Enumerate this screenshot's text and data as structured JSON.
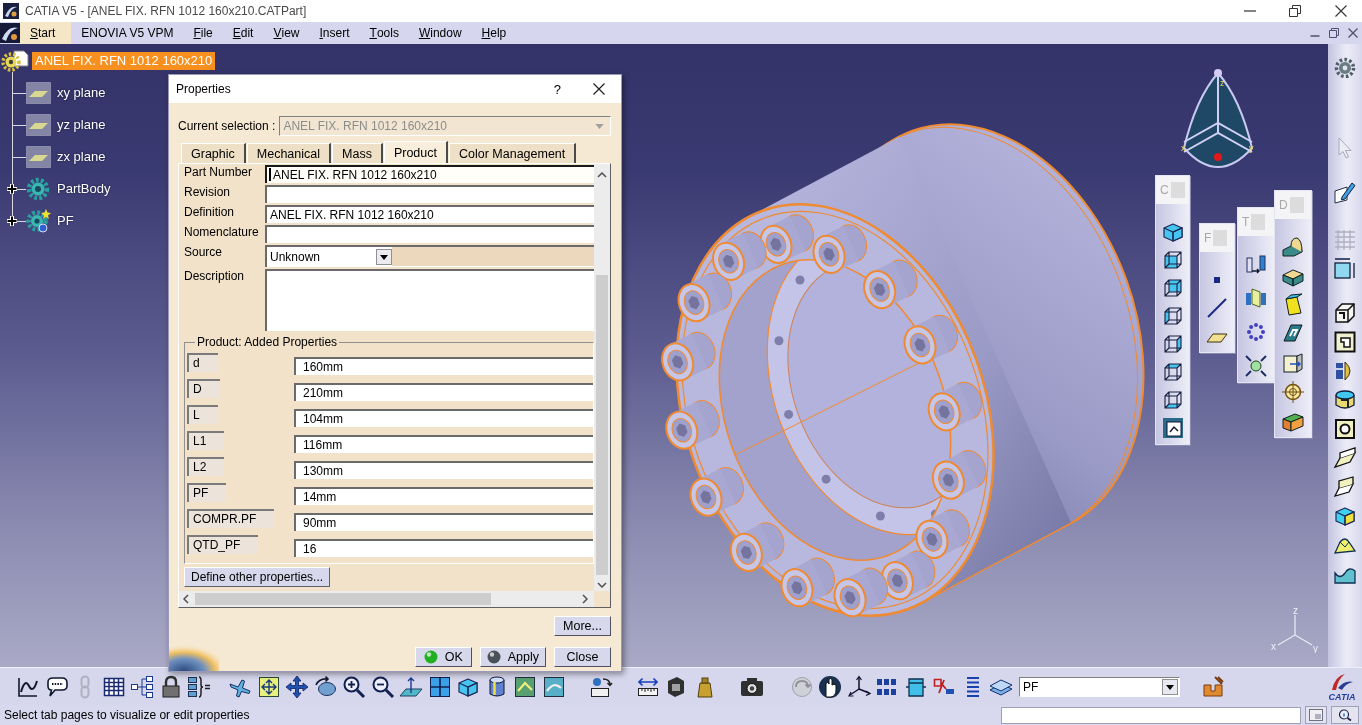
{
  "window": {
    "title": "CATIA V5 - [ANEL FIX. RFN 1012 160x210.CATPart]"
  },
  "menu": [
    {
      "label": "Start",
      "mnemonic": true,
      "selected": true
    },
    {
      "label": "ENOVIA V5 VPM",
      "mnemonic": false,
      "selected": false
    },
    {
      "label": "File",
      "mnemonic": true,
      "selected": false
    },
    {
      "label": "Edit",
      "mnemonic": true,
      "selected": false
    },
    {
      "label": "View",
      "mnemonic": true,
      "selected": false
    },
    {
      "label": "Insert",
      "mnemonic": true,
      "selected": false
    },
    {
      "label": "Tools",
      "mnemonic": true,
      "selected": false
    },
    {
      "label": "Window",
      "mnemonic": true,
      "selected": false
    },
    {
      "label": "Help",
      "mnemonic": true,
      "selected": false
    }
  ],
  "tree": {
    "label": "ANEL FIX. RFN 1012 160x210",
    "selected": true,
    "children": [
      {
        "label": "xy plane",
        "kind": "plane",
        "selected": false
      },
      {
        "label": "yz plane",
        "kind": "plane",
        "selected": false
      },
      {
        "label": "zx plane",
        "kind": "plane",
        "selected": false
      },
      {
        "label": "PartBody",
        "kind": "body",
        "expanded": false,
        "selected": false
      },
      {
        "label": "PF",
        "kind": "set",
        "expanded": false,
        "selected": false
      }
    ]
  },
  "compass": {
    "labels": [
      "z",
      "x",
      "y"
    ]
  },
  "floating_toolbars": [
    {
      "title": "C"
    },
    {
      "title": "F"
    },
    {
      "title": "T"
    },
    {
      "title": "D"
    }
  ],
  "axis_triad": {
    "labels": [
      "z",
      "x",
      "y"
    ]
  },
  "dialog": {
    "title": "Properties",
    "help": "?",
    "current_selection": {
      "label": "Current selection :",
      "value": "ANEL FIX. RFN 1012 160x210",
      "disabled": true
    },
    "tabs": [
      {
        "label": "Graphic",
        "selected": false
      },
      {
        "label": "Mechanical",
        "selected": false
      },
      {
        "label": "Mass",
        "selected": false
      },
      {
        "label": "Product",
        "selected": true
      },
      {
        "label": "Color Management",
        "selected": false
      }
    ],
    "fields": [
      {
        "label": "Part Number",
        "kind": "text",
        "value": "ANEL FIX. RFN 1012 160x210",
        "focused": true
      },
      {
        "label": "Revision",
        "kind": "text",
        "focused": false
      },
      {
        "label": "Definition",
        "kind": "text",
        "value": "ANEL FIX. RFN 1012 160x210",
        "focused": false
      },
      {
        "label": "Nomenclature",
        "kind": "text",
        "focused": false
      },
      {
        "label": "Source",
        "kind": "dropdown",
        "value": "Unknown"
      },
      {
        "label": "Description",
        "kind": "textarea"
      }
    ],
    "added_properties": {
      "title": "Product: Added Properties",
      "rows": [
        {
          "name": "d",
          "value": "160mm"
        },
        {
          "name": "D",
          "value": "210mm"
        },
        {
          "name": "L",
          "value": "104mm"
        },
        {
          "name": "L1",
          "value": "116mm"
        },
        {
          "name": "L2",
          "value": "130mm"
        },
        {
          "name": "PF",
          "value": "14mm"
        },
        {
          "name": "COMPR.PF",
          "value": "90mm"
        },
        {
          "name": "QTD_PF",
          "value": "16"
        }
      ]
    },
    "define_button": "Define other properties...",
    "more_button": "More...",
    "buttons": [
      {
        "label": "OK",
        "kind": "ok"
      },
      {
        "label": "Apply",
        "kind": "apply"
      },
      {
        "label": "Close",
        "kind": "close"
      }
    ]
  },
  "bottom_toolbar": {
    "layer": "PF"
  },
  "logo": {
    "text": "CATIA"
  },
  "status_bar": {
    "message": "Select tab pages to visualize or edit properties"
  }
}
